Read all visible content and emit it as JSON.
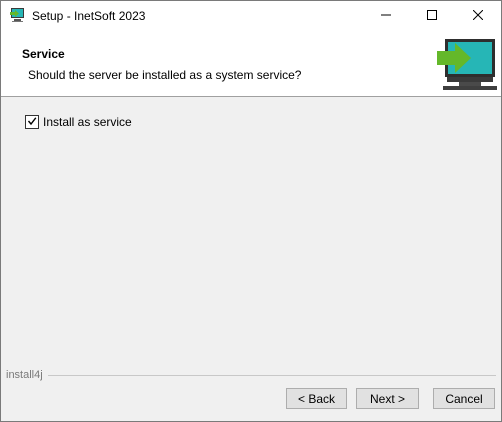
{
  "window": {
    "title": "Setup - InetSoft 2023",
    "icon": "installer-app-icon",
    "controls": {
      "minimize_icon": "minimize-icon",
      "maximize_icon": "maximize-icon",
      "close_icon": "close-icon"
    }
  },
  "header": {
    "title": "Service",
    "subtitle": "Should the server be installed as a system service?",
    "graphic": "monitor-install-arrow-icon"
  },
  "content": {
    "install_service": {
      "label": "Install as service",
      "checked": true
    }
  },
  "footer": {
    "brand": "install4j",
    "back_label": "< Back",
    "next_label": "Next >",
    "cancel_label": "Cancel"
  },
  "colors": {
    "background": "#f0f0f0",
    "header_background": "#ffffff",
    "button_background": "#e1e1e1",
    "monitor_screen": "#26b6b6",
    "arrow": "#64b82a"
  }
}
